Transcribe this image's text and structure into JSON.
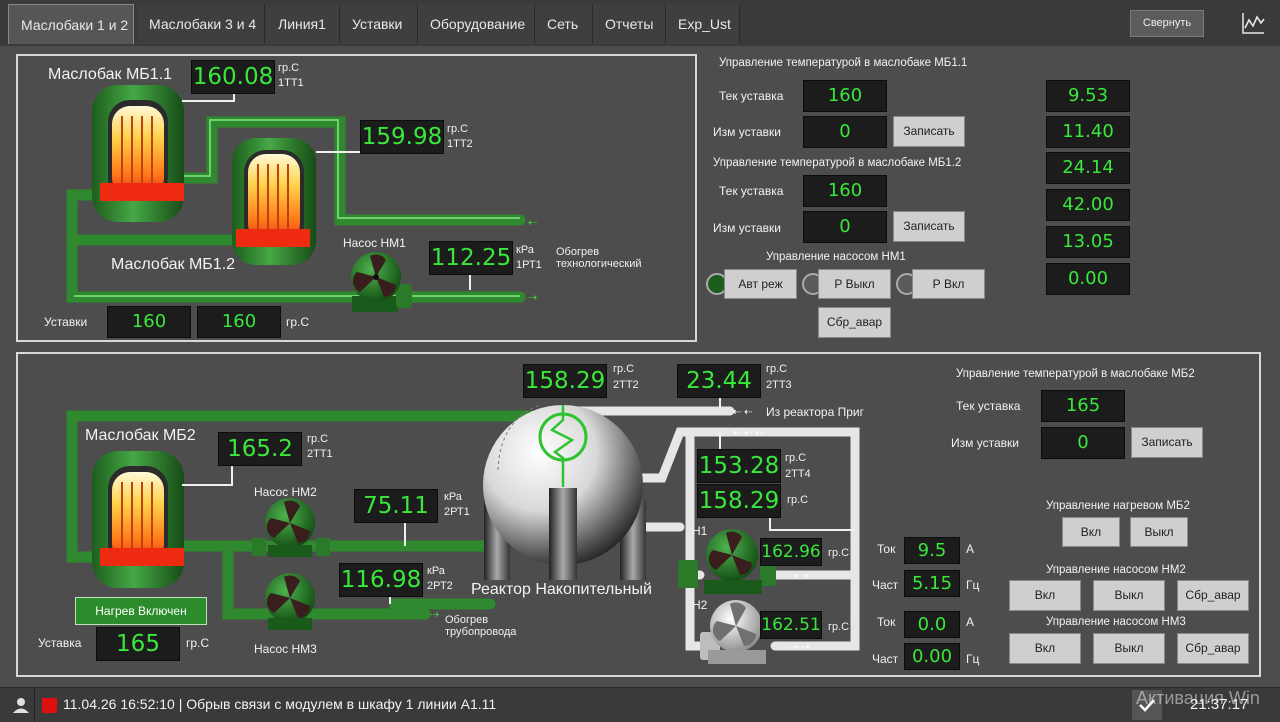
{
  "tabs": [
    "Маслобаки 1 и 2",
    "Маслобаки 3 и 4",
    "Линия1",
    "Уставки",
    "Оборудование",
    "Сеть",
    "Отчеты",
    "Exp_Ust"
  ],
  "header": {
    "collapse_label": "Свернуть",
    "chart_icon": "trend-chart-icon"
  },
  "top_panel": {
    "tank1_title": "Маслобак МБ1.1",
    "tank2_title": "Маслобак МБ1.2",
    "tt1": {
      "value": "160.08",
      "unit": "гр.С",
      "tag": "1ТТ1"
    },
    "tt2": {
      "value": "159.98",
      "unit": "гр.С",
      "tag": "1ТТ2"
    },
    "pump_label": "Насос НМ1",
    "pt1": {
      "value": "112.25",
      "unit": "кРа",
      "tag": "1РТ1"
    },
    "heating_label_1": "Обогрев",
    "heating_label_2": "технологический",
    "setpoints_label": "Уставки",
    "setpoint1": "160",
    "setpoint2": "160",
    "setpoint_unit": "гр.С"
  },
  "top_right": {
    "ctrl1_title": "Управление температурой в маслобаке МБ1.1",
    "cur_label": "Тек уставка",
    "change_label": "Изм уставки",
    "write_label": "Записать",
    "ctrl1_cur": "160",
    "ctrl1_new": "0",
    "ctrl2_title": "Управление температурой в маслобаке МБ1.2",
    "ctrl2_cur": "160",
    "ctrl2_new": "0",
    "pump_title": "Управление насосом НМ1",
    "btn_auto": "Авт реж",
    "btn_off": "Р Выкл",
    "btn_on": "Р Вкл",
    "btn_reset": "Сбр_авар",
    "right_values": [
      "9.53",
      "11.40",
      "24.14",
      "42.00",
      "13.05",
      "0.00"
    ]
  },
  "bottom_panel": {
    "tank_title": "Маслобак МБ2",
    "tt1": {
      "value": "165.2",
      "unit": "гр.С",
      "tag": "2ТТ1"
    },
    "pump2_label": "Насос НМ2",
    "pump3_label": "Насос НМ3",
    "pt1": {
      "value": "75.11",
      "unit": "кРа",
      "tag": "2РТ1"
    },
    "pt2": {
      "value": "116.98",
      "unit": "кРа",
      "tag": "2РТ2"
    },
    "heating_status": "Нагрев Включен",
    "setpoint_label": "Уставка",
    "setpoint_value": "165",
    "setpoint_unit": "гр.С",
    "pipe_heating_1": "Обогрев",
    "pipe_heating_2": "трубопровода",
    "reactor_label": "Реактор Накопительный",
    "tt2": {
      "value": "158.29",
      "unit": "гр.С",
      "tag": "2ТТ2"
    },
    "tt3": {
      "value": "23.44",
      "unit": "гр.С",
      "tag": "2ТТ3"
    },
    "from_reactor": "Из реактора Приг",
    "tt4": {
      "value": "153.28",
      "unit": "гр.С",
      "tag": "2ТТ4"
    },
    "t5": {
      "value": "158.29",
      "unit": "гр.С"
    },
    "h1_label": "Н1",
    "h2_label": "Н2",
    "h1_temp": {
      "value": "162.96",
      "unit": "гр.С"
    },
    "h2_temp": {
      "value": "162.51",
      "unit": "гр.С"
    },
    "current_label": "Ток",
    "freq_label": "Част",
    "h1_current": "9.5",
    "h1_freq": "5.15",
    "h2_current": "0.0",
    "h2_freq": "0.00",
    "amp_unit": "А",
    "hz_unit": "Гц"
  },
  "bottom_right": {
    "ctrl_title": "Управление температурой в маслобаке МБ2",
    "cur_label": "Тек уставка",
    "change_label": "Изм уставки",
    "cur_value": "165",
    "new_value": "0",
    "write_label": "Записать",
    "heat_title": "Управление нагревом МБ2",
    "heat_on": "Вкл",
    "heat_off": "Выкл",
    "nm2_title": "Управление насосом НМ2",
    "nm3_title": "Управление насосом НМ3",
    "on": "Вкл",
    "off": "Выкл",
    "reset": "Сбр_авар"
  },
  "status": {
    "alarm_text": "11.04.26 16:52:10 | Обрыв связи с модулем в шкафу 1 линии А1.11",
    "time": "21:37:17",
    "watermark": "Активация Win"
  }
}
